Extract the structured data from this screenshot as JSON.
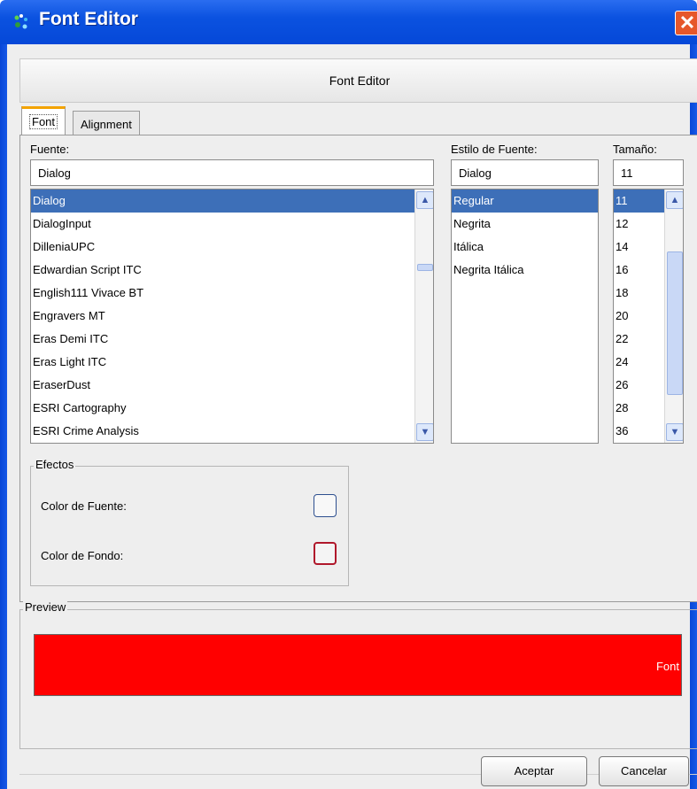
{
  "window": {
    "title": "Font Editor",
    "close_glyph": "✕"
  },
  "header": {
    "title": "Font Editor"
  },
  "tabs": [
    {
      "label": "Font"
    },
    {
      "label": "Alignment"
    }
  ],
  "font_panel": {
    "fuente": {
      "label": "Fuente:",
      "value": "Dialog",
      "items": [
        "Dialog",
        "DialogInput",
        "DilleniaUPC",
        "Edwardian Script ITC",
        "English111 Vivace BT",
        "Engravers MT",
        "Eras Demi ITC",
        "Eras Light ITC",
        "EraserDust",
        "ESRI Cartography",
        "ESRI Crime Analysis"
      ],
      "selected": "Dialog"
    },
    "estilo": {
      "label": "Estilo de Fuente:",
      "value": "Dialog",
      "items": [
        "Regular",
        "Negrita",
        "Itálica",
        "Negrita Itálica"
      ],
      "selected": "Regular"
    },
    "tamano": {
      "label": "Tamaño:",
      "value": "11",
      "items": [
        "11",
        "12",
        "14",
        "16",
        "18",
        "20",
        "22",
        "24",
        "26",
        "28",
        "36"
      ],
      "selected": "11"
    }
  },
  "efectos": {
    "legend": "Efectos",
    "font_color_label": "Color de Fuente:",
    "background_color_label": "Color de Fondo:",
    "font_color": "#ffffff",
    "background_color": "#ff0000"
  },
  "preview": {
    "legend": "Preview",
    "text": "Font",
    "background": "#ff0000",
    "text_color": "#ffffff"
  },
  "buttons": {
    "accept": "Aceptar",
    "cancel": "Cancelar"
  }
}
